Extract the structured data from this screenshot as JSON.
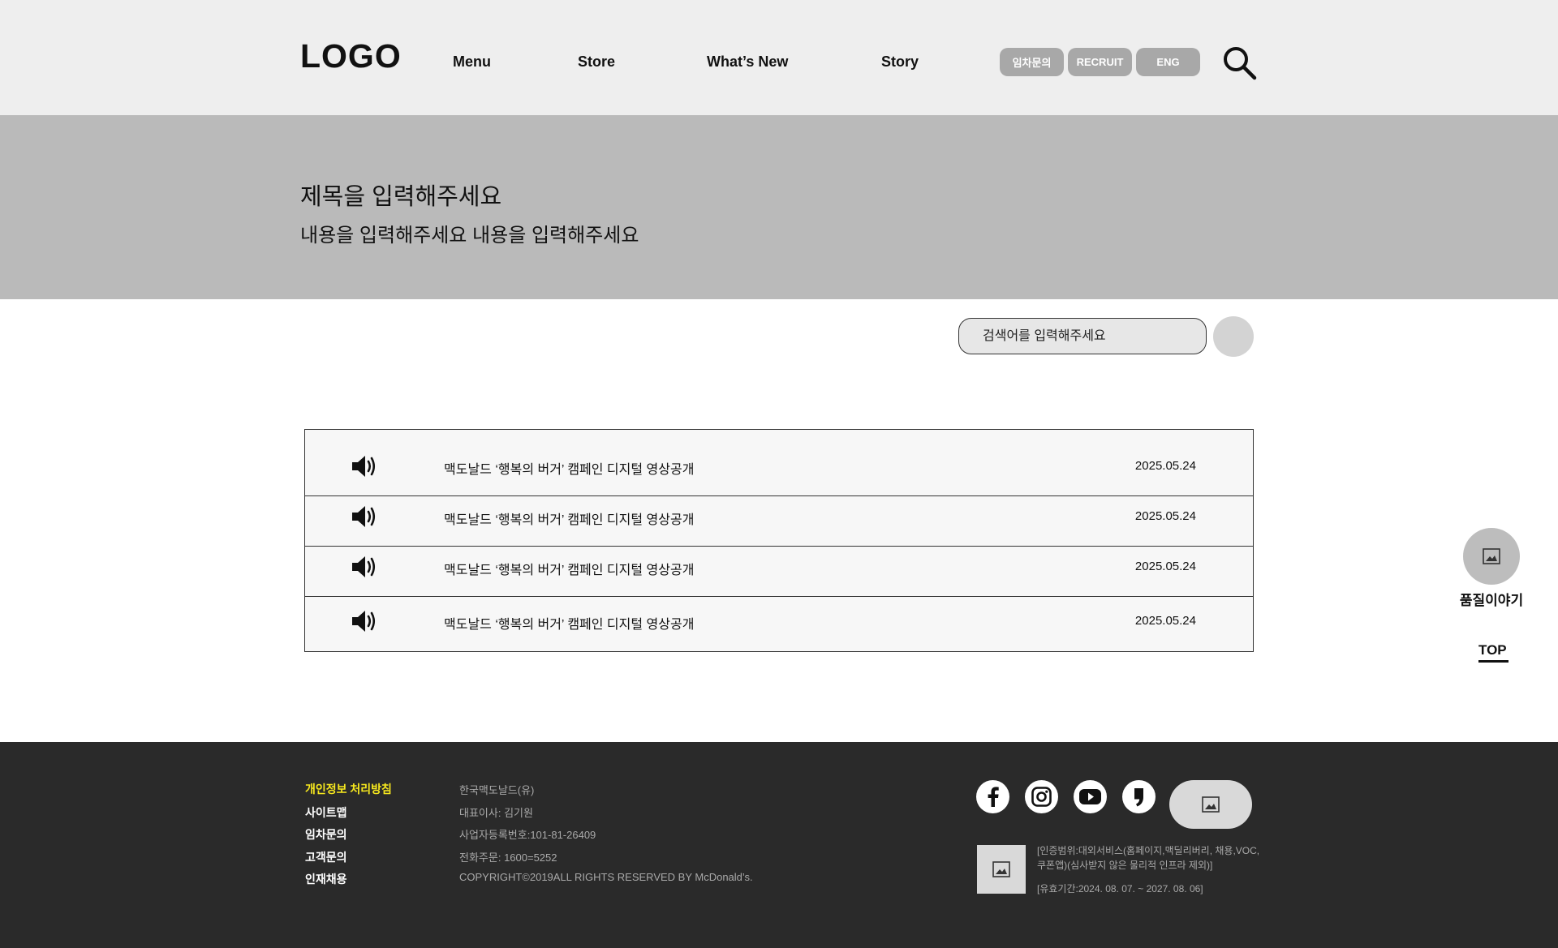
{
  "header": {
    "logo": "LOGO",
    "nav": [
      "Menu",
      "Store",
      "What’s New",
      "Story"
    ],
    "pills": [
      "임차문의",
      "RECRUIT",
      "ENG"
    ],
    "search_icon": "search-icon"
  },
  "banner": {
    "title": "제목을 입력해주세요",
    "description": "내용을 입력해주세요 내용을 입력해주세요"
  },
  "search": {
    "placeholder": "검색어를 입력해주세요"
  },
  "notices": [
    {
      "icon": "speaker-icon",
      "title": "맥도날드 ‘행복의 버거’ 캠페인 디지털 영상공개",
      "date": "2025.05.24"
    },
    {
      "icon": "speaker-icon",
      "title": "맥도날드 ‘행복의 버거’ 캠페인 디지털 영상공개",
      "date": "2025.05.24"
    },
    {
      "icon": "speaker-icon",
      "title": "맥도날드 ‘행복의 버거’ 캠페인 디지털 영상공개",
      "date": "2025.05.24"
    },
    {
      "icon": "speaker-icon",
      "title": "맥도날드 ‘행복의 버거’ 캠페인 디지털 영상공개",
      "date": "2025.05.24"
    }
  ],
  "side": {
    "quality_label": "품질이야기",
    "top_label": "TOP"
  },
  "footer": {
    "links": [
      "개인정보 처리방침",
      "사이트맵",
      "임차문의",
      "고객문의",
      "인재채용"
    ],
    "highlight_color": "#f7e81e",
    "info": [
      "한국맥도날드(유)",
      "대표이사: 김기원",
      "사업자등록번호:101-81-26409",
      "전화주문: 1600=5252",
      "COPYRIGHT©2019ALL RIGHTS RESERVED BY McDonald’s."
    ],
    "sns": [
      "facebook-icon",
      "instagram-icon",
      "youtube-icon",
      "blog-icon"
    ],
    "cert_line1": "[인증범위:대외서비스(홈페이지,맥딜리버리, 채용,VOC,",
    "cert_line2": "쿠폰앱)(심사받지 않은 물리적 인프라 제외)]",
    "cert_valid": "[유효기간:2024. 08. 07. ~ 2027. 08. 06]"
  }
}
